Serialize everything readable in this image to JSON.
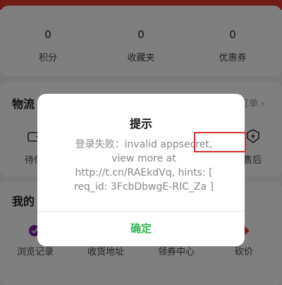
{
  "stats": [
    {
      "value": "0",
      "label": "积分"
    },
    {
      "value": "0",
      "label": "收藏夹"
    },
    {
      "value": "0",
      "label": "优惠券"
    }
  ],
  "logistics": {
    "title": "物流",
    "more": "订单",
    "items": [
      {
        "label": "待付",
        "icon": "wallet-icon"
      },
      {
        "label": "售后",
        "icon": "after-sales-icon"
      }
    ]
  },
  "mine": {
    "title": "我的",
    "items": [
      {
        "label": "浏览记录",
        "icon": "history-icon"
      },
      {
        "label": "收货地址",
        "icon": "address-icon"
      },
      {
        "label": "领券中心",
        "icon": "coupon-icon"
      },
      {
        "label": "砍价",
        "icon": "bargain-icon"
      }
    ]
  },
  "dialog": {
    "title": "提示",
    "message": "登录失败：invalid appsecret, view more at http://t.cn/RAEkdVq, hints: [ req_id: 3FcbDbwgE-RIC_Za ]",
    "ok_label": "确定"
  },
  "colors": {
    "brand": "#e53935",
    "confirm": "#2db84d",
    "highlight": "#d32f2f"
  }
}
